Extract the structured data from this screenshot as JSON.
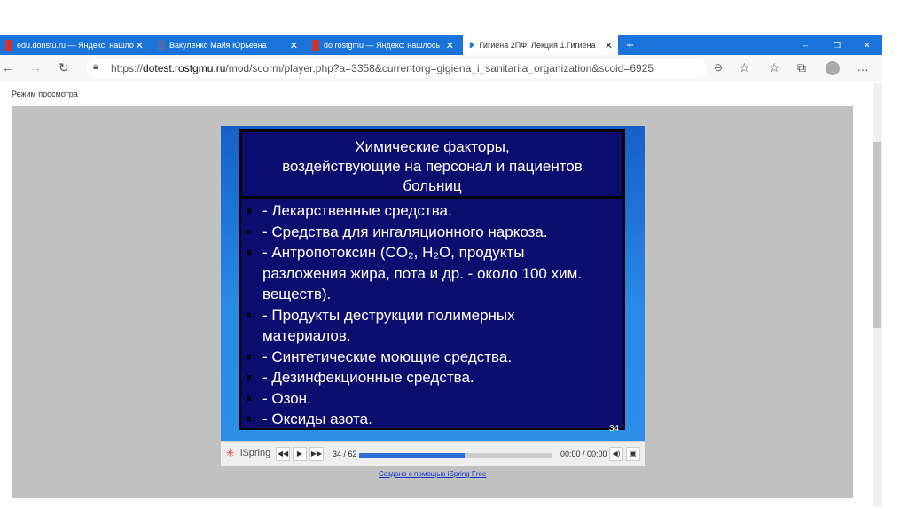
{
  "tabs": [
    {
      "label": "edu.donstu.ru — Яндекс: нашло",
      "active": false
    },
    {
      "label": "Вакуленко Майя Юрьевна",
      "active": false
    },
    {
      "label": "do rostgmu — Яндекс: нашлось",
      "active": false
    },
    {
      "label": "Гигиена 2ПФ: Лекция 1.Гигиена",
      "active": true
    }
  ],
  "window_controls": {
    "minimize": "–",
    "maximize": "❐",
    "close": "✕"
  },
  "address": {
    "prefix": "https://",
    "domain": "dotest.rostgmu.ru",
    "path": "/mod/scorm/player.php?a=3358&currentorg=gigiena_i_sanitariia_organization&scoid=6925"
  },
  "page": {
    "mode_label": "Режим просмотра"
  },
  "slide": {
    "title_lines": [
      "Химические факторы,",
      "воздействующие на персонал и пациентов",
      "больниц"
    ],
    "items": [
      "- Лекарственные средства.",
      "- Средства для ингаляционного наркоза.",
      "- Антропотоксин (CO₂, H₂O, продукты",
      "разложения жира, пота и др. - около 100 хим.",
      "веществ).",
      "- Продукты деструкции полимерных",
      "материалов.",
      "- Синтетические моющие средства.",
      "- Дезинфекционные средства.",
      "- Озон.",
      "- Оксиды азота."
    ],
    "number": "34"
  },
  "player": {
    "brand": "iSpring",
    "slide_counter": "34 / 62",
    "progress": 0.55,
    "time": "00:00 / 00:00"
  },
  "footer_link": "Создано с помощью iSpring Free"
}
